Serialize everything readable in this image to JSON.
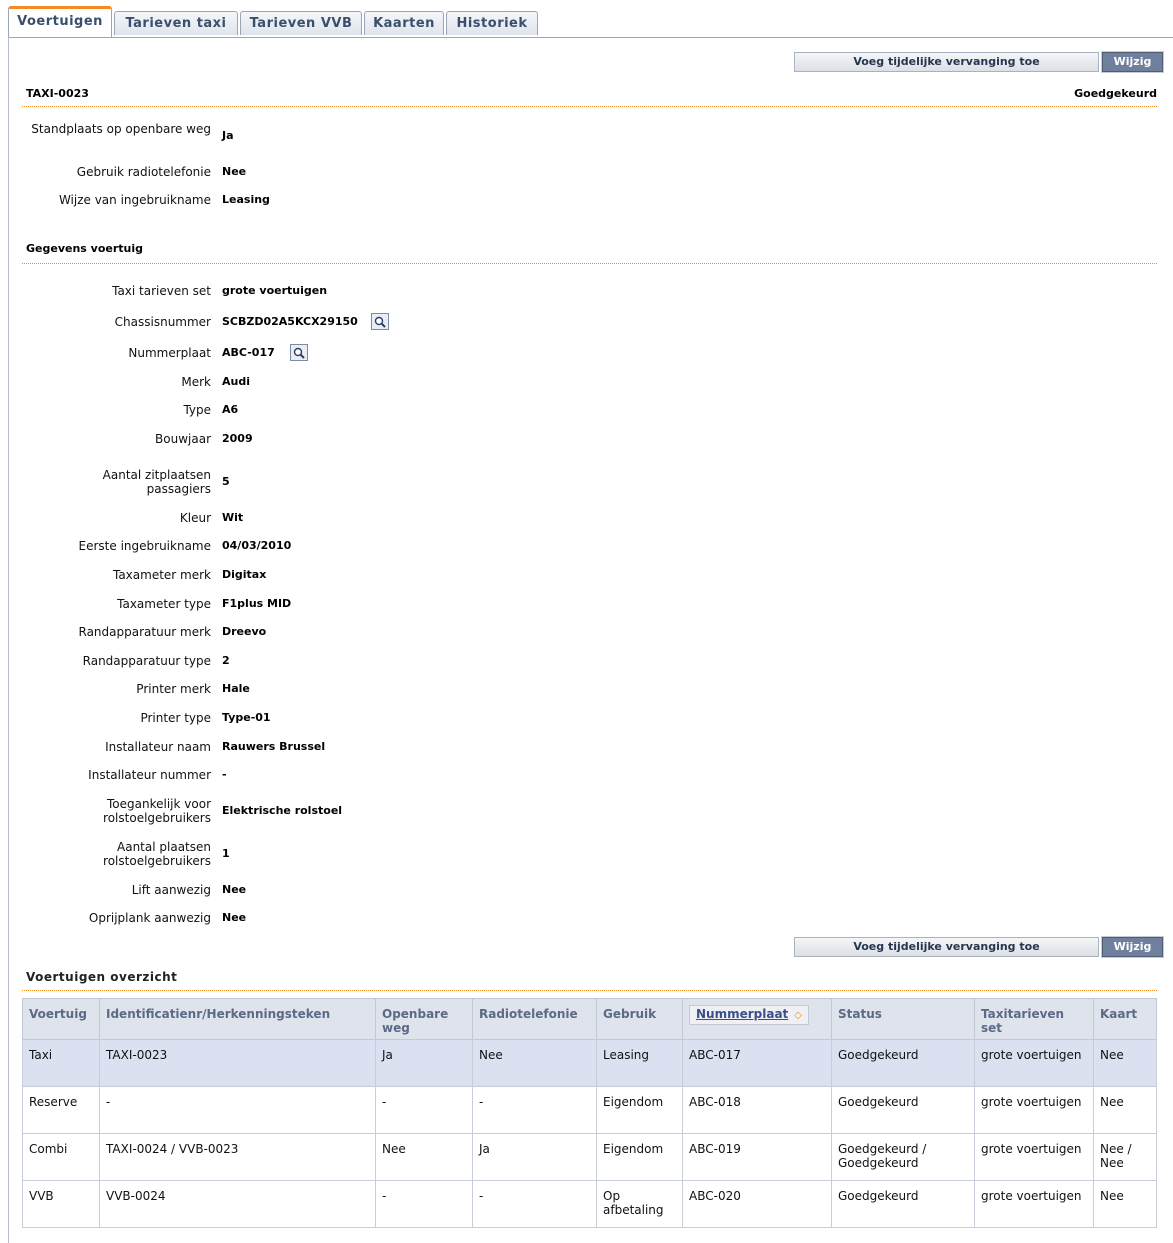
{
  "tabs": [
    "Voertuigen",
    "Tarieven taxi",
    "Tarieven VVB",
    "Kaarten",
    "Historiek"
  ],
  "buttons": {
    "add_replacement": "Voeg tijdelijke vervanging toe",
    "edit": "Wijzig"
  },
  "vehicle": {
    "id": "TAXI-0023",
    "status": "Goedgekeurd"
  },
  "general_fields": [
    {
      "label": "Standplaats op openbare weg",
      "value": "Ja"
    },
    {
      "label": "Gebruik radiotelefonie",
      "value": "Nee"
    },
    {
      "label": "Wijze van ingebruikname",
      "value": "Leasing"
    }
  ],
  "details_title": "Gegevens voertuig",
  "detail_fields": [
    {
      "label": "Taxi tarieven set",
      "value": "grote voertuigen"
    },
    {
      "label": "Chassisnummer",
      "value": "SCBZD02A5KCX29150"
    },
    {
      "label": "Nummerplaat",
      "value": "ABC-017"
    },
    {
      "label": "Merk",
      "value": "Audi"
    },
    {
      "label": "Type",
      "value": "A6"
    },
    {
      "label": "Bouwjaar",
      "value": "2009"
    },
    {
      "label": "Aantal zitplaatsen passagiers",
      "value": "5"
    },
    {
      "label": "Kleur",
      "value": "Wit"
    },
    {
      "label": "Eerste ingebruikname",
      "value": "04/03/2010"
    },
    {
      "label": "Taxameter merk",
      "value": "Digitax"
    },
    {
      "label": "Taxameter type",
      "value": "F1plus MID"
    },
    {
      "label": "Randapparatuur merk",
      "value": "Dreevo"
    },
    {
      "label": "Randapparatuur type",
      "value": "2"
    },
    {
      "label": "Printer merk",
      "value": "Hale"
    },
    {
      "label": "Printer type",
      "value": "Type-01"
    },
    {
      "label": "Installateur naam",
      "value": "Rauwers Brussel"
    },
    {
      "label": "Installateur nummer",
      "value": "-"
    },
    {
      "label": "Toegankelijk voor rolstoelgebruikers",
      "value": "Elektrische rolstoel"
    },
    {
      "label": "Aantal plaatsen rolstoelgebruikers",
      "value": "1"
    },
    {
      "label": "Lift aanwezig",
      "value": "Nee"
    },
    {
      "label": "Oprijplank aanwezig",
      "value": "Nee"
    }
  ],
  "overview": {
    "title": "Voertuigen overzicht",
    "columns": [
      "Voertuig",
      "Identificatienr/Herkenningsteken",
      "Openbare weg",
      "Radiotelefonie",
      "Gebruik",
      "Nummerplaat",
      "Status",
      "Taxitarieven set",
      "Kaart"
    ],
    "rows": [
      [
        "Taxi",
        "TAXI-0023",
        "Ja",
        "Nee",
        "Leasing",
        "ABC-017",
        "Goedgekeurd",
        "grote voertuigen",
        "Nee"
      ],
      [
        "Reserve",
        "-",
        "-",
        "-",
        "Eigendom",
        "ABC-018",
        "Goedgekeurd",
        "grote voertuigen",
        "Nee"
      ],
      [
        "Combi",
        "TAXI-0024 / VVB-0023",
        "Nee",
        "Ja",
        "Eigendom",
        "ABC-019",
        "Goedgekeurd / Goedgekeurd",
        "grote voertuigen",
        "Nee / Nee"
      ],
      [
        "VVB",
        "VVB-0024",
        "-",
        "-",
        "Op afbetaling",
        "ABC-020",
        "Goedgekeurd",
        "grote voertuigen",
        "Nee"
      ]
    ]
  },
  "icons": {
    "lookup": "magnifier-icon",
    "sort": "sort-arrow-icon"
  },
  "colors": {
    "accent": "#f28b23",
    "tab_text": "#3a4f6e",
    "edit_button": "#6f7f9c",
    "highlight_row": "#dbe1f0"
  }
}
